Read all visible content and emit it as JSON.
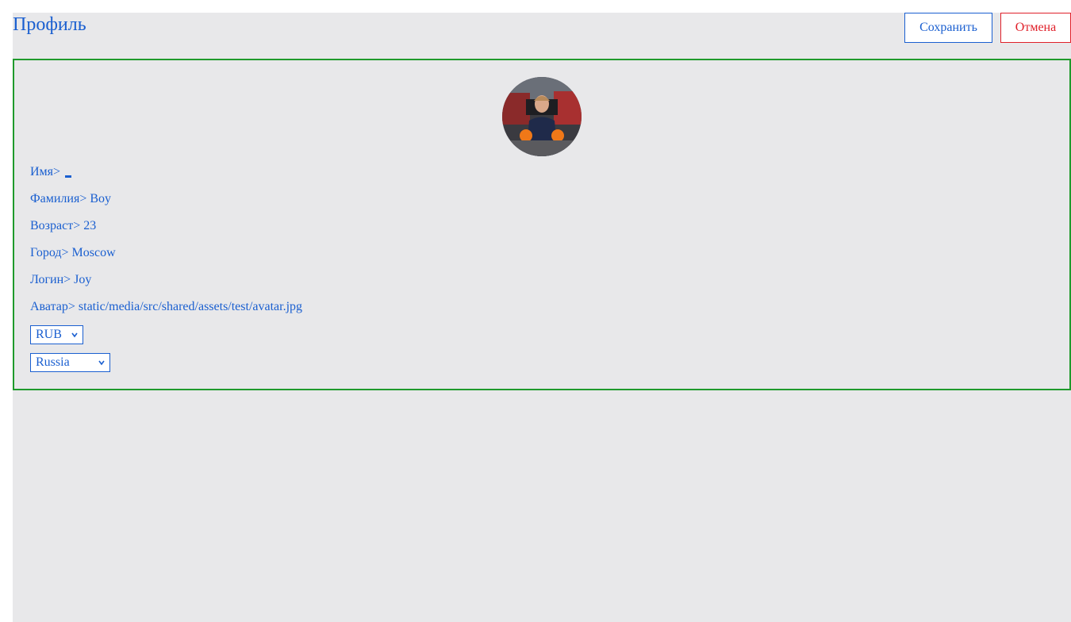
{
  "header": {
    "title": "Профиль",
    "save_label": "Сохранить",
    "cancel_label": "Отмена"
  },
  "profile": {
    "avatar_icon": "avatar-photo",
    "fields": [
      {
        "label": "Имя>",
        "value": ""
      },
      {
        "label": "Фамилия>",
        "value": "Boy"
      },
      {
        "label": "Возраст>",
        "value": "23"
      },
      {
        "label": "Город>",
        "value": "Moscow"
      },
      {
        "label": "Логин>",
        "value": "Joy"
      },
      {
        "label": "Аватар>",
        "value": "static/media/src/shared/assets/test/avatar.jpg"
      }
    ],
    "currency_select": "RUB",
    "country_select": "Russia"
  },
  "colors": {
    "accent": "#1a5fd0",
    "danger": "#e0202a",
    "border_green": "#1f9a2c",
    "background": "#e8e8ea"
  }
}
